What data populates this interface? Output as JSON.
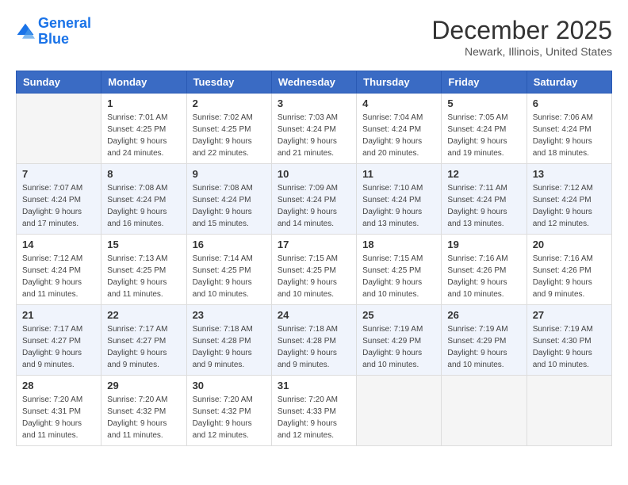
{
  "logo": {
    "line1": "General",
    "line2": "Blue"
  },
  "title": "December 2025",
  "location": "Newark, Illinois, United States",
  "headers": [
    "Sunday",
    "Monday",
    "Tuesday",
    "Wednesday",
    "Thursday",
    "Friday",
    "Saturday"
  ],
  "weeks": [
    [
      {
        "day": "",
        "info": ""
      },
      {
        "day": "1",
        "info": "Sunrise: 7:01 AM\nSunset: 4:25 PM\nDaylight: 9 hours\nand 24 minutes."
      },
      {
        "day": "2",
        "info": "Sunrise: 7:02 AM\nSunset: 4:25 PM\nDaylight: 9 hours\nand 22 minutes."
      },
      {
        "day": "3",
        "info": "Sunrise: 7:03 AM\nSunset: 4:24 PM\nDaylight: 9 hours\nand 21 minutes."
      },
      {
        "day": "4",
        "info": "Sunrise: 7:04 AM\nSunset: 4:24 PM\nDaylight: 9 hours\nand 20 minutes."
      },
      {
        "day": "5",
        "info": "Sunrise: 7:05 AM\nSunset: 4:24 PM\nDaylight: 9 hours\nand 19 minutes."
      },
      {
        "day": "6",
        "info": "Sunrise: 7:06 AM\nSunset: 4:24 PM\nDaylight: 9 hours\nand 18 minutes."
      }
    ],
    [
      {
        "day": "7",
        "info": "Sunrise: 7:07 AM\nSunset: 4:24 PM\nDaylight: 9 hours\nand 17 minutes."
      },
      {
        "day": "8",
        "info": "Sunrise: 7:08 AM\nSunset: 4:24 PM\nDaylight: 9 hours\nand 16 minutes."
      },
      {
        "day": "9",
        "info": "Sunrise: 7:08 AM\nSunset: 4:24 PM\nDaylight: 9 hours\nand 15 minutes."
      },
      {
        "day": "10",
        "info": "Sunrise: 7:09 AM\nSunset: 4:24 PM\nDaylight: 9 hours\nand 14 minutes."
      },
      {
        "day": "11",
        "info": "Sunrise: 7:10 AM\nSunset: 4:24 PM\nDaylight: 9 hours\nand 13 minutes."
      },
      {
        "day": "12",
        "info": "Sunrise: 7:11 AM\nSunset: 4:24 PM\nDaylight: 9 hours\nand 13 minutes."
      },
      {
        "day": "13",
        "info": "Sunrise: 7:12 AM\nSunset: 4:24 PM\nDaylight: 9 hours\nand 12 minutes."
      }
    ],
    [
      {
        "day": "14",
        "info": "Sunrise: 7:12 AM\nSunset: 4:24 PM\nDaylight: 9 hours\nand 11 minutes."
      },
      {
        "day": "15",
        "info": "Sunrise: 7:13 AM\nSunset: 4:25 PM\nDaylight: 9 hours\nand 11 minutes."
      },
      {
        "day": "16",
        "info": "Sunrise: 7:14 AM\nSunset: 4:25 PM\nDaylight: 9 hours\nand 10 minutes."
      },
      {
        "day": "17",
        "info": "Sunrise: 7:15 AM\nSunset: 4:25 PM\nDaylight: 9 hours\nand 10 minutes."
      },
      {
        "day": "18",
        "info": "Sunrise: 7:15 AM\nSunset: 4:25 PM\nDaylight: 9 hours\nand 10 minutes."
      },
      {
        "day": "19",
        "info": "Sunrise: 7:16 AM\nSunset: 4:26 PM\nDaylight: 9 hours\nand 10 minutes."
      },
      {
        "day": "20",
        "info": "Sunrise: 7:16 AM\nSunset: 4:26 PM\nDaylight: 9 hours\nand 9 minutes."
      }
    ],
    [
      {
        "day": "21",
        "info": "Sunrise: 7:17 AM\nSunset: 4:27 PM\nDaylight: 9 hours\nand 9 minutes."
      },
      {
        "day": "22",
        "info": "Sunrise: 7:17 AM\nSunset: 4:27 PM\nDaylight: 9 hours\nand 9 minutes."
      },
      {
        "day": "23",
        "info": "Sunrise: 7:18 AM\nSunset: 4:28 PM\nDaylight: 9 hours\nand 9 minutes."
      },
      {
        "day": "24",
        "info": "Sunrise: 7:18 AM\nSunset: 4:28 PM\nDaylight: 9 hours\nand 9 minutes."
      },
      {
        "day": "25",
        "info": "Sunrise: 7:19 AM\nSunset: 4:29 PM\nDaylight: 9 hours\nand 10 minutes."
      },
      {
        "day": "26",
        "info": "Sunrise: 7:19 AM\nSunset: 4:29 PM\nDaylight: 9 hours\nand 10 minutes."
      },
      {
        "day": "27",
        "info": "Sunrise: 7:19 AM\nSunset: 4:30 PM\nDaylight: 9 hours\nand 10 minutes."
      }
    ],
    [
      {
        "day": "28",
        "info": "Sunrise: 7:20 AM\nSunset: 4:31 PM\nDaylight: 9 hours\nand 11 minutes."
      },
      {
        "day": "29",
        "info": "Sunrise: 7:20 AM\nSunset: 4:32 PM\nDaylight: 9 hours\nand 11 minutes."
      },
      {
        "day": "30",
        "info": "Sunrise: 7:20 AM\nSunset: 4:32 PM\nDaylight: 9 hours\nand 12 minutes."
      },
      {
        "day": "31",
        "info": "Sunrise: 7:20 AM\nSunset: 4:33 PM\nDaylight: 9 hours\nand 12 minutes."
      },
      {
        "day": "",
        "info": ""
      },
      {
        "day": "",
        "info": ""
      },
      {
        "day": "",
        "info": ""
      }
    ]
  ]
}
